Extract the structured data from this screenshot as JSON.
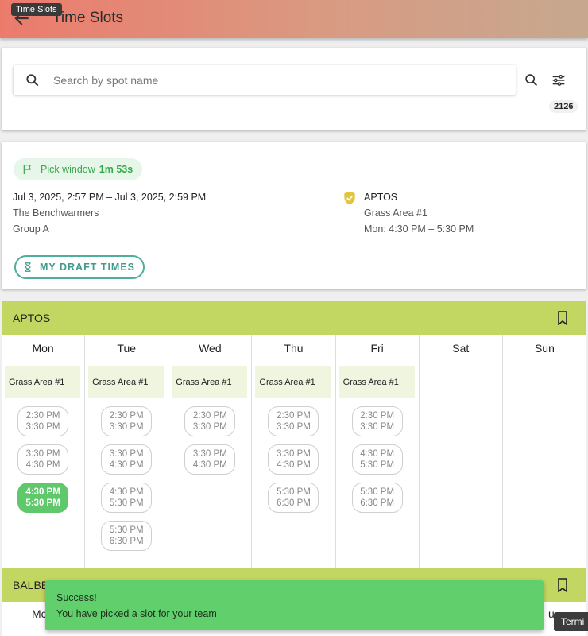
{
  "header": {
    "tooltip": "Time Slots",
    "title": "Time Slots"
  },
  "search": {
    "placeholder": "Search by spot name",
    "value": "",
    "count": "2126"
  },
  "pick": {
    "label": "Pick window",
    "timer": "1m 53s",
    "dates": "Jul 3, 2025, 2:57 PM – Jul 3, 2025, 2:59 PM",
    "team": "The Benchwarmers",
    "group": "Group A",
    "location": "APTOS",
    "area": "Grass Area #1",
    "slot": "Mon: 4:30 PM – 5:30 PM",
    "draft_button": "MY DRAFT TIMES"
  },
  "schedule": [
    {
      "name": "APTOS",
      "days": [
        {
          "label": "Mon",
          "area": "Grass Area #1",
          "slots": [
            {
              "start": "2:30 PM",
              "end": "3:30 PM",
              "selected": false
            },
            {
              "start": "3:30 PM",
              "end": "4:30 PM",
              "selected": false
            },
            {
              "start": "4:30 PM",
              "end": "5:30 PM",
              "selected": true
            }
          ]
        },
        {
          "label": "Tue",
          "area": "Grass Area #1",
          "slots": [
            {
              "start": "2:30 PM",
              "end": "3:30 PM",
              "selected": false
            },
            {
              "start": "3:30 PM",
              "end": "4:30 PM",
              "selected": false
            },
            {
              "start": "4:30 PM",
              "end": "5:30 PM",
              "selected": false
            },
            {
              "start": "5:30 PM",
              "end": "6:30 PM",
              "selected": false
            }
          ]
        },
        {
          "label": "Wed",
          "area": "Grass Area #1",
          "slots": [
            {
              "start": "2:30 PM",
              "end": "3:30 PM",
              "selected": false
            },
            {
              "start": "3:30 PM",
              "end": "4:30 PM",
              "selected": false
            }
          ]
        },
        {
          "label": "Thu",
          "area": "Grass Area #1",
          "slots": [
            {
              "start": "2:30 PM",
              "end": "3:30 PM",
              "selected": false
            },
            {
              "start": "3:30 PM",
              "end": "4:30 PM",
              "selected": false
            },
            {
              "start": "5:30 PM",
              "end": "6:30 PM",
              "selected": false
            }
          ]
        },
        {
          "label": "Fri",
          "area": "Grass Area #1",
          "slots": [
            {
              "start": "2:30 PM",
              "end": "3:30 PM",
              "selected": false
            },
            {
              "start": "4:30 PM",
              "end": "5:30 PM",
              "selected": false
            },
            {
              "start": "5:30 PM",
              "end": "6:30 PM",
              "selected": false
            }
          ]
        },
        {
          "label": "Sat",
          "area": "",
          "slots": []
        },
        {
          "label": "Sun",
          "area": "",
          "slots": []
        }
      ]
    }
  ],
  "section2": {
    "name": "BALBE",
    "day_first": "Mo",
    "day_last": "u"
  },
  "toast": {
    "title": "Success!",
    "message": "You have picked a slot for your team"
  },
  "terminal_tooltip": "Termi"
}
